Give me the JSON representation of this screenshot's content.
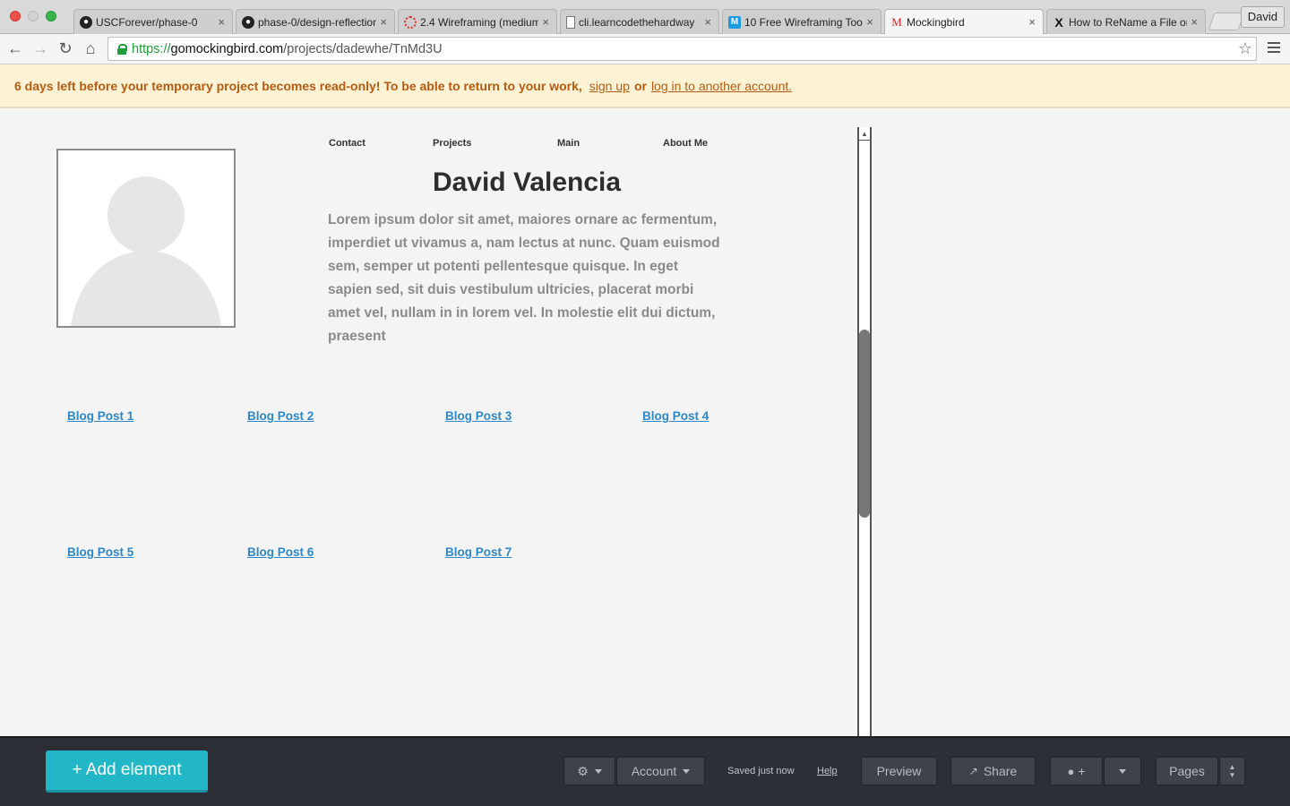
{
  "browser": {
    "tabs": [
      {
        "title": "USCForever/phase-0",
        "icon": "github-icon"
      },
      {
        "title": "phase-0/design-reflection",
        "icon": "github-icon"
      },
      {
        "title": "2.4 Wireframing (medium",
        "icon": "loading-icon"
      },
      {
        "title": "cli.learncodethehardway",
        "icon": "page-icon"
      },
      {
        "title": "10 Free Wireframing Too",
        "icon": "m-logo-icon"
      },
      {
        "title": "Mockingbird",
        "icon": "mockingbird-icon"
      },
      {
        "title": "How to ReName a File or",
        "icon": "x-logo-icon"
      }
    ],
    "active_tab": 5,
    "user": "David",
    "url": {
      "scheme": "https://",
      "host": "gomockingbird.com",
      "path": "/projects/dadewhe/TnMd3U"
    }
  },
  "banner": {
    "message": "6 days left before your temporary project becomes read-only! To be able to return to your work,",
    "signup": "sign up",
    "or": "or",
    "login": "log in to another account."
  },
  "wireframe": {
    "nav": [
      "Contact",
      "Projects",
      "Main",
      "About Me"
    ],
    "name": "David Valencia",
    "body": "Lorem ipsum dolor sit amet, maiores ornare ac fermentum, imperdiet ut vivamus a, nam lectus at nunc. Quam euismod sem, semper ut potenti pellentesque quisque. In eget sapien sed, sit duis vestibulum ultricies, placerat morbi amet vel, nullam in in lorem vel. In molestie elit dui dictum, praesent",
    "blog_posts": [
      "Blog Post 1",
      "Blog Post 2",
      "Blog Post 3",
      "Blog Post 4",
      "Blog Post 5",
      "Blog Post 6",
      "Blog Post 7"
    ]
  },
  "bottombar": {
    "add": "+ Add element",
    "account": "Account",
    "saved": "Saved just now",
    "help": "Help",
    "preview": "Preview",
    "share": "Share",
    "comment": "+",
    "pages": "Pages"
  },
  "colors": {
    "accent": "#22b7c7",
    "link": "#2e87c8",
    "banner_text": "#b65a12",
    "banner_bg": "#fdf3d4"
  }
}
